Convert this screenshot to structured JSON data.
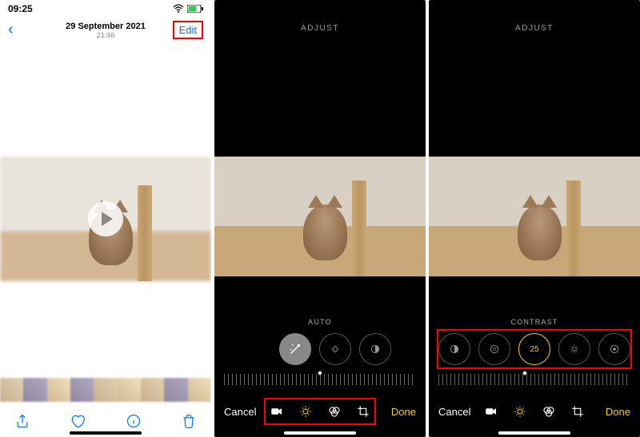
{
  "panel1": {
    "status": {
      "time": "09:25"
    },
    "nav": {
      "date": "29 September 2021",
      "time": "21:46",
      "edit": "Edit"
    }
  },
  "panel2": {
    "header": "ADJUST",
    "sublabel": "AUTO",
    "bottom": {
      "cancel": "Cancel",
      "done": "Done"
    }
  },
  "panel3": {
    "header": "ADJUST",
    "sublabel": "CONTRAST",
    "value": "25",
    "bottom": {
      "cancel": "Cancel",
      "done": "Done"
    }
  }
}
